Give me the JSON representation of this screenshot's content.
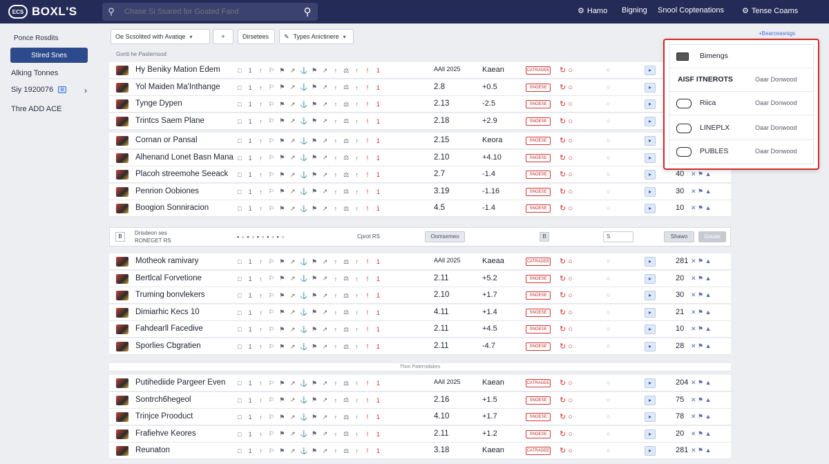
{
  "app": {
    "logo_text": "BOXL'S",
    "logo_badge": "ECS"
  },
  "search": {
    "placeholder": "Chase Si Ssared for Goated Fand"
  },
  "nav": [
    {
      "label": "Hamo",
      "icon": "gear-icon"
    },
    {
      "label": "Bigning",
      "icon": ""
    },
    {
      "label": "Snool Coptenations",
      "icon": ""
    },
    {
      "label": "Tense Coams",
      "icon": "user-icon"
    }
  ],
  "sidebar": {
    "heading": "Ponce Rosdits",
    "active": "Stired Snes",
    "items": [
      "Alking Tonnes",
      "Siy 1920076",
      "Thre ADD ACE"
    ],
    "badge": "B"
  },
  "filters": {
    "sort_label": "Oe Scsolited with Avatiqe",
    "plus": "+",
    "discovery": "Dirsetees",
    "type_label": "Types Anictinere"
  },
  "labels": {
    "section1": "Gonti he Pasternsod",
    "section2": "Thon Paternidakes",
    "pager_text": "Drisdeon ses",
    "pager_sub": "RONEGET RS",
    "pager_count": "Cprot RS",
    "pager_select": "Oomsemeo",
    "pager_num": "S",
    "pager_action": "Shawo",
    "pager_go": "Gouas",
    "headlink": "+Bearceasnigs"
  },
  "rows_a": [
    {
      "name": "Hy Beniky Mation Edem",
      "value": "AAll 2025",
      "chg": "Kaean",
      "tag": "CATRAGEE",
      "icon": "cursor"
    },
    {
      "name": "Yol Maiden Ma'Inthange",
      "value": "2.8",
      "chg": "+0.5",
      "tag": "SNOESE",
      "icon": ""
    },
    {
      "name": "Tynge Dypen",
      "value": "2.13",
      "chg": "-2.5",
      "tag": "SNOESE",
      "icon": ""
    },
    {
      "name": "Trintcs Saem Plane",
      "value": "2.18",
      "chg": "+2.9",
      "tag": "SNOESE",
      "icon": ""
    }
  ],
  "rows_b": [
    {
      "name": "Cornan or Pansal",
      "value": "2.15",
      "chg": "Keora",
      "tag": "SNOESE",
      "num": "",
      "sym": ""
    },
    {
      "name": "Alhenand Lonet Basn Mana",
      "value": "2.10",
      "chg": "+4.10",
      "tag": "SNOESE",
      "num": "",
      "sym": ""
    },
    {
      "name": "Placoh streemohe Seeack",
      "value": "2.7",
      "chg": "-1.4",
      "tag": "SNOESE",
      "num": "40",
      "sym": "✕ ⚑ ▲"
    },
    {
      "name": "Penrion Oobiones",
      "value": "3.19",
      "chg": "-1.16",
      "tag": "SNOESE",
      "num": "30",
      "sym": "✕ ⚑ ▲"
    },
    {
      "name": "Boogion Sonniracion",
      "value": "4.5",
      "chg": "-1.4",
      "tag": "SNOESE",
      "num": "10",
      "sym": "✕ ⚑ ▲"
    }
  ],
  "rows_c": [
    {
      "name": "Motheok ramivary",
      "value": "AAll 2025",
      "chg": "Kaeaa",
      "tag": "CATRAGEE",
      "num": "281",
      "sym": "✕ ⚑ ▲"
    },
    {
      "name": "Bertlcal Forvetione",
      "value": "2.11",
      "chg": "+5.2",
      "tag": "SNOESE",
      "num": "20",
      "sym": "✕ ⚑ ▲"
    },
    {
      "name": "Truming bonvlekers",
      "value": "2.10",
      "chg": "+1.7",
      "tag": "SNOESE",
      "num": "30",
      "sym": "✕ ⚑ ▲"
    },
    {
      "name": "Dimiarhic Kecs 10",
      "value": "4.11",
      "chg": "+1.4",
      "tag": "SNOESE",
      "num": "21",
      "sym": "✕ ⚑ ▲"
    },
    {
      "name": "Fahdearll Facedive",
      "value": "2.11",
      "chg": "+4.5",
      "tag": "SNOESE",
      "num": "10",
      "sym": "✕ ⚑ ▲"
    },
    {
      "name": "Sporlies Cbgratien",
      "value": "2.11",
      "chg": "-4.7",
      "tag": "SNOESE",
      "num": "28",
      "sym": "✕ ⚑ ▲"
    }
  ],
  "rows_d": [
    {
      "name": "Putihediide Pargeer Even",
      "value": "AAll 2025",
      "chg": "Kaean",
      "tag": "CATRAGEE",
      "num": "204",
      "sym": "✕ ⚑ ▲"
    },
    {
      "name": "Sontrch6hegeol",
      "value": "2.16",
      "chg": "+1.5",
      "tag": "SNOESE",
      "num": "75",
      "sym": "✕ ⚑ ▲"
    },
    {
      "name": "Trinjce Prooduct",
      "value": "4.10",
      "chg": "+1.7",
      "tag": "SNOESE",
      "num": "78",
      "sym": "✕ ⚑ ▲"
    },
    {
      "name": "Frafiehve Keores",
      "value": "2.11",
      "chg": "+1.2",
      "tag": "SNOESE",
      "num": "20",
      "sym": "✕ ⚑ ▲"
    },
    {
      "name": "Reunaton",
      "value": "3.18",
      "chg": "Kaean",
      "tag": "CATRAGEE",
      "num": "281",
      "sym": "✕ ⚑ ▲"
    }
  ],
  "popup": {
    "title": "Bimengs",
    "items": [
      {
        "label": "AISF ITNEROTS",
        "status": "Oaar Donwood"
      },
      {
        "label": "Riica",
        "status": "Oaar Donwood"
      },
      {
        "label": "LINEPLX",
        "status": "Oaar Donwood"
      },
      {
        "label": "PUBLES",
        "status": "Oaar Donwood"
      }
    ]
  },
  "colors": {
    "topbar": "#242b56",
    "accent": "#2c4a8c",
    "popup_border": "#d02626",
    "tag_red": "#d23434"
  }
}
